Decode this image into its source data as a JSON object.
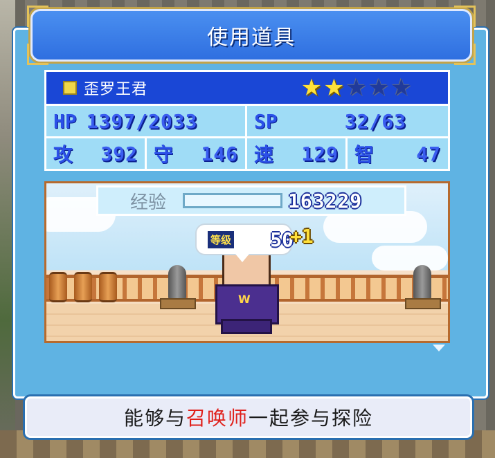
{
  "dialog": {
    "title": "使用道具"
  },
  "character": {
    "name": "歪罗王君",
    "stars": {
      "filled": 2,
      "total": 5
    },
    "hp": {
      "label": "HP",
      "value": "1397/2033"
    },
    "sp": {
      "label": "SP",
      "value": "32/63"
    },
    "atk": {
      "label": "攻",
      "value": "392"
    },
    "def": {
      "label": "守",
      "value": "146"
    },
    "spd": {
      "label": "速",
      "value": "129"
    },
    "int": {
      "label": "智",
      "value": "47"
    }
  },
  "experience": {
    "label": "经验",
    "value": "163229",
    "progress": 0.0
  },
  "level": {
    "label": "等级",
    "value": "50",
    "bonus": "+1"
  },
  "message": {
    "prefix": "能够与",
    "highlight": "召唤师",
    "suffix": "一起参与探险"
  },
  "colors": {
    "dialog_bg": "#5fb3e3",
    "title_bg": "#2f6fe0",
    "name_row_bg": "#1a47d6",
    "stat_cell_bg": "#9fdcf6",
    "star_on": "#ffe23a",
    "highlight_text": "#e0201b"
  }
}
